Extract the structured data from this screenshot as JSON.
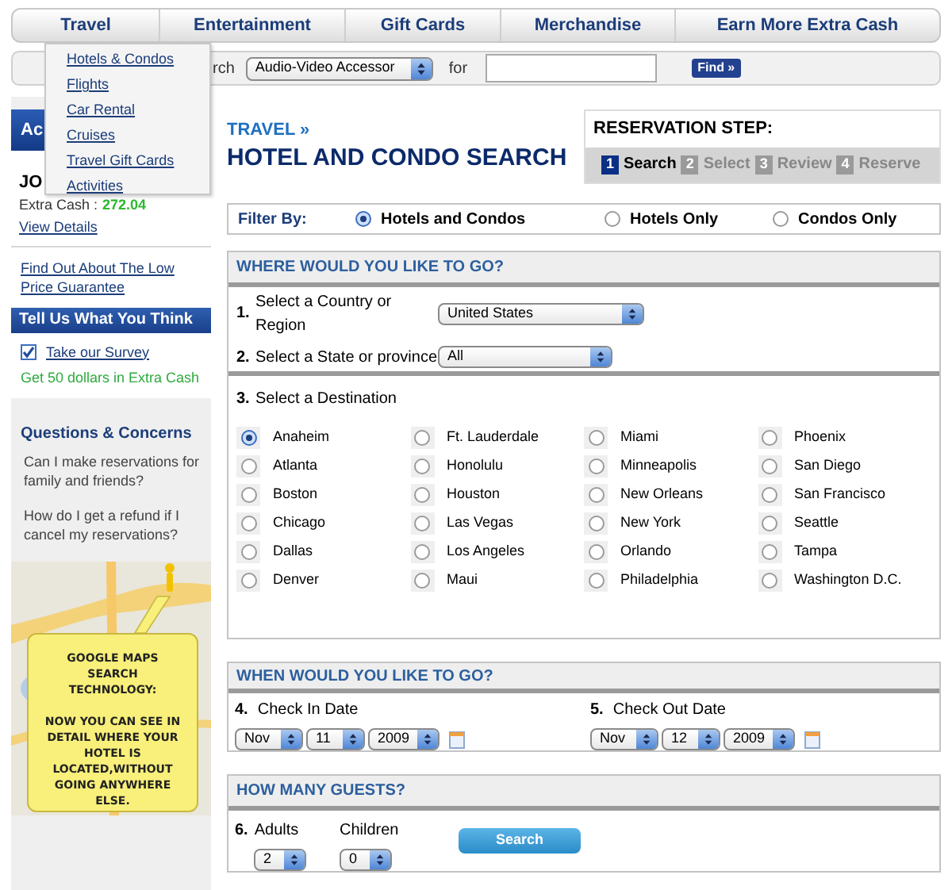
{
  "nav": {
    "items": [
      "Travel",
      "Entertainment",
      "Gift Cards",
      "Merchandise",
      "Earn More Extra Cash"
    ]
  },
  "travel_menu": {
    "items": [
      "Hotels & Condos",
      "Flights",
      "Car Rental",
      "Cruises",
      "Travel Gift Cards",
      "Activities"
    ]
  },
  "search_bar": {
    "label": "rch",
    "category": "Audio-Video Accessor",
    "for_label": "for",
    "button": "Find »"
  },
  "sidebar": {
    "account_header": "Ac",
    "name": "JO",
    "extra_cash_label": "Extra Cash :",
    "extra_cash_value": "272.04",
    "view_details": "View Details",
    "guarantee_link": "Find Out About The Low Price Guarantee",
    "feedback_header": "Tell Us What You Think",
    "survey": {
      "label": "Take our Survey",
      "checked": true
    },
    "survey_note": "Get 50 dollars in Extra Cash",
    "questions_title": "Questions & Concerns",
    "questions": [
      "Can I make reservations for family and friends?",
      "How do I get a refund if I cancel my reservations?"
    ],
    "map_ad": {
      "kind": "picture",
      "title": "GOOGLE MAPS SEARCH TECHNOLOGY:",
      "text": "NOW YOU CAN SEE IN DETAIL WHERE YOUR HOTEL IS LOCATED,WITHOUT GOING ANYWHERE ELSE."
    }
  },
  "page": {
    "breadcrumb": "TRAVEL »",
    "title": "HOTEL AND CONDO SEARCH"
  },
  "reservation_step": {
    "title": "RESERVATION STEP:",
    "steps": [
      {
        "number": "1",
        "label": "Search",
        "selected": true
      },
      {
        "number": "2",
        "label": "Select",
        "selected": false
      },
      {
        "number": "3",
        "label": "Review",
        "selected": false
      },
      {
        "number": "4",
        "label": "Reserve",
        "selected": false
      }
    ]
  },
  "filter": {
    "label": "Filter By:",
    "options": [
      {
        "label": "Hotels and Condos",
        "selected": true
      },
      {
        "label": "Hotels Only",
        "selected": false
      },
      {
        "label": "Condos Only",
        "selected": false
      }
    ]
  },
  "where": {
    "title": "WHERE WOULD YOU LIKE TO GO?",
    "country": {
      "number": "1.",
      "label": "Select a Country or Region",
      "value": "United States"
    },
    "state": {
      "number": "2.",
      "label": "Select a State or province",
      "value": "All"
    },
    "destination": {
      "number": "3.",
      "label": "Select a Destination",
      "options": [
        {
          "label": "Anaheim",
          "selected": true
        },
        {
          "label": "Atlanta",
          "selected": false
        },
        {
          "label": "Boston",
          "selected": false
        },
        {
          "label": "Chicago",
          "selected": false
        },
        {
          "label": "Dallas",
          "selected": false
        },
        {
          "label": "Denver",
          "selected": false
        },
        {
          "label": "Ft. Lauderdale",
          "selected": false
        },
        {
          "label": "Honolulu",
          "selected": false
        },
        {
          "label": "Houston",
          "selected": false
        },
        {
          "label": "Las Vegas",
          "selected": false
        },
        {
          "label": "Los Angeles",
          "selected": false
        },
        {
          "label": "Maui",
          "selected": false
        },
        {
          "label": "Miami",
          "selected": false
        },
        {
          "label": "Minneapolis",
          "selected": false
        },
        {
          "label": "New Orleans",
          "selected": false
        },
        {
          "label": "New York",
          "selected": false
        },
        {
          "label": "Orlando",
          "selected": false
        },
        {
          "label": "Philadelphia",
          "selected": false
        },
        {
          "label": "Phoenix",
          "selected": false
        },
        {
          "label": "San Diego",
          "selected": false
        },
        {
          "label": "San Francisco",
          "selected": false
        },
        {
          "label": "Seattle",
          "selected": false
        },
        {
          "label": "Tampa",
          "selected": false
        },
        {
          "label": "Washington D.C.",
          "selected": false
        }
      ]
    }
  },
  "when": {
    "title": "WHEN WOULD YOU LIKE TO GO?",
    "check_in": {
      "number": "4.",
      "label": "Check In Date",
      "month": "Nov",
      "day": "11",
      "year": "2009"
    },
    "check_out": {
      "number": "5.",
      "label": "Check Out Date",
      "month": "Nov",
      "day": "12",
      "year": "2009"
    }
  },
  "guests": {
    "title": "HOW MANY GUESTS?",
    "number": "6.",
    "adults": {
      "label": "Adults",
      "value": "2"
    },
    "children": {
      "label": "Children",
      "value": "0"
    },
    "button": "Search"
  }
}
